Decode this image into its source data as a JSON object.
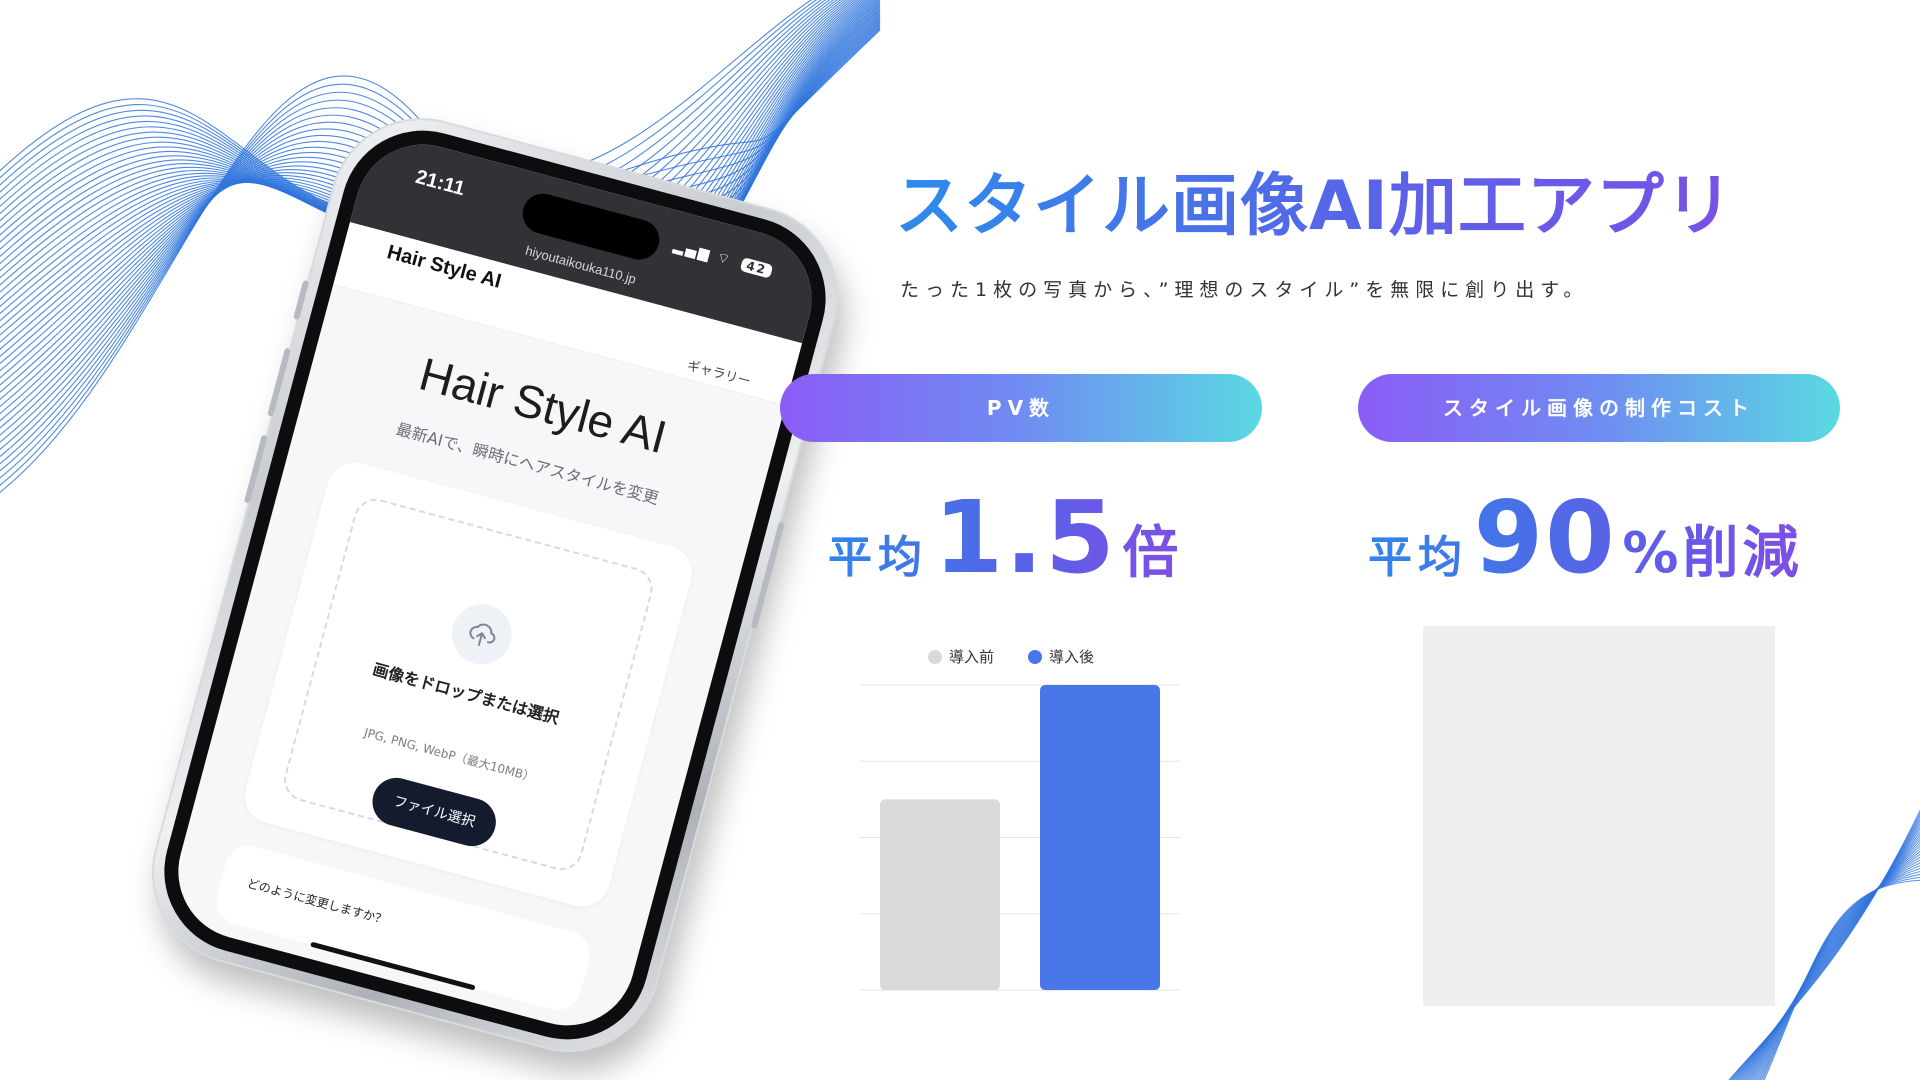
{
  "slide": {
    "title": "スタイル画像AI加工アプリ",
    "subtitle": "たった1枚の写真から、”理想のスタイル”を無限に創り出す。"
  },
  "phone": {
    "status_time": "21:11",
    "battery": "42",
    "url": "hiyoutaikouka110.jp",
    "app_brand": "Hair Style AI",
    "nav_gallery": "ギャラリー",
    "hero_title": "Hair Style AI",
    "hero_subtitle": "最新AIで、瞬時にヘアスタイルを変更",
    "drop_text": "画像をドロップまたは選択",
    "drop_hint": "JPG, PNG, WebP（最大10MB）",
    "file_button": "ファイル選択",
    "next_question": "どのように変更しますか？"
  },
  "metrics": [
    {
      "label": "PV数",
      "prefix": "平均",
      "value": "1.5",
      "suffix": "倍"
    },
    {
      "label": "スタイル画像の制作コスト",
      "prefix": "平均",
      "value": "90",
      "suffix": "%削減"
    }
  ],
  "colors": {
    "accent_blue": "#4876e8",
    "bar_gray": "#d9d9d9",
    "gradient_start": "#8b5cf6",
    "gradient_end": "#5ad9e2"
  },
  "chart_data": {
    "type": "bar",
    "categories": [
      "導入前",
      "導入後"
    ],
    "values": [
      1.0,
      1.6
    ],
    "legend": [
      "導入前",
      "導入後"
    ],
    "legend_position": "top",
    "grid": true,
    "ylim": [
      0,
      1.6
    ],
    "colors": [
      "#d9d9d9",
      "#4876e8"
    ]
  }
}
